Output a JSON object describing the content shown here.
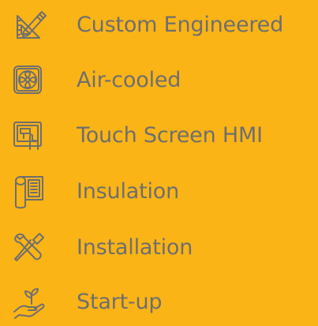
{
  "colors": {
    "background": "#FBB416",
    "text": "#6E6E70",
    "icon": "#6E6E70"
  },
  "features": [
    {
      "label": "Custom Engineered",
      "icon": "ruler-pencil-icon"
    },
    {
      "label": "Air-cooled",
      "icon": "fan-icon"
    },
    {
      "label": "Touch Screen HMI",
      "icon": "touch-screen-icon"
    },
    {
      "label": "Insulation",
      "icon": "insulation-roll-icon"
    },
    {
      "label": "Installation",
      "icon": "tools-icon"
    },
    {
      "label": "Start-up",
      "icon": "sprout-hand-icon"
    }
  ]
}
